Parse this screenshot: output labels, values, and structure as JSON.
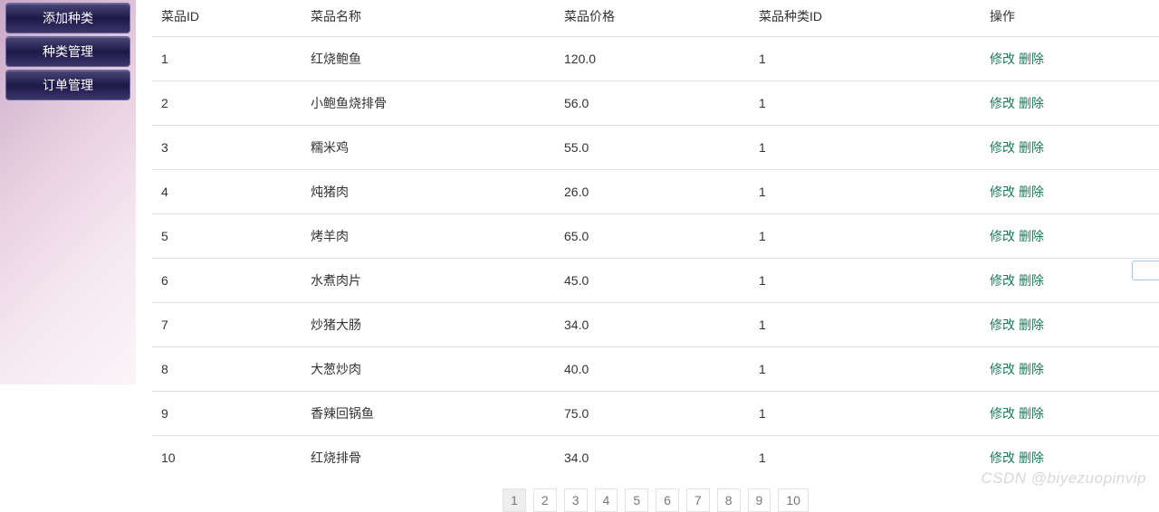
{
  "sidebar": {
    "items": [
      {
        "label": "添加种类"
      },
      {
        "label": "种类管理"
      },
      {
        "label": "订单管理"
      }
    ]
  },
  "table": {
    "headers": {
      "id": "菜品ID",
      "name": "菜品名称",
      "price": "菜品价格",
      "category": "菜品种类ID",
      "op": "操作"
    },
    "op_labels": {
      "edit": "修改",
      "delete": "删除"
    },
    "rows": [
      {
        "id": "1",
        "name": "红烧鲍鱼",
        "price": "120.0",
        "category": "1"
      },
      {
        "id": "2",
        "name": "小鲍鱼烧排骨",
        "price": "56.0",
        "category": "1"
      },
      {
        "id": "3",
        "name": "糯米鸡",
        "price": "55.0",
        "category": "1"
      },
      {
        "id": "4",
        "name": "炖猪肉",
        "price": "26.0",
        "category": "1"
      },
      {
        "id": "5",
        "name": "烤羊肉",
        "price": "65.0",
        "category": "1"
      },
      {
        "id": "6",
        "name": "水煮肉片",
        "price": "45.0",
        "category": "1"
      },
      {
        "id": "7",
        "name": "炒猪大肠",
        "price": "34.0",
        "category": "1"
      },
      {
        "id": "8",
        "name": "大葱炒肉",
        "price": "40.0",
        "category": "1"
      },
      {
        "id": "9",
        "name": "香辣回锅鱼",
        "price": "75.0",
        "category": "1"
      },
      {
        "id": "10",
        "name": "红烧排骨",
        "price": "34.0",
        "category": "1"
      }
    ]
  },
  "pagination": {
    "pages": [
      "1",
      "2",
      "3",
      "4",
      "5",
      "6",
      "7",
      "8",
      "9",
      "10"
    ],
    "current": "1"
  },
  "watermark": "CSDN @biyezuopinvip"
}
